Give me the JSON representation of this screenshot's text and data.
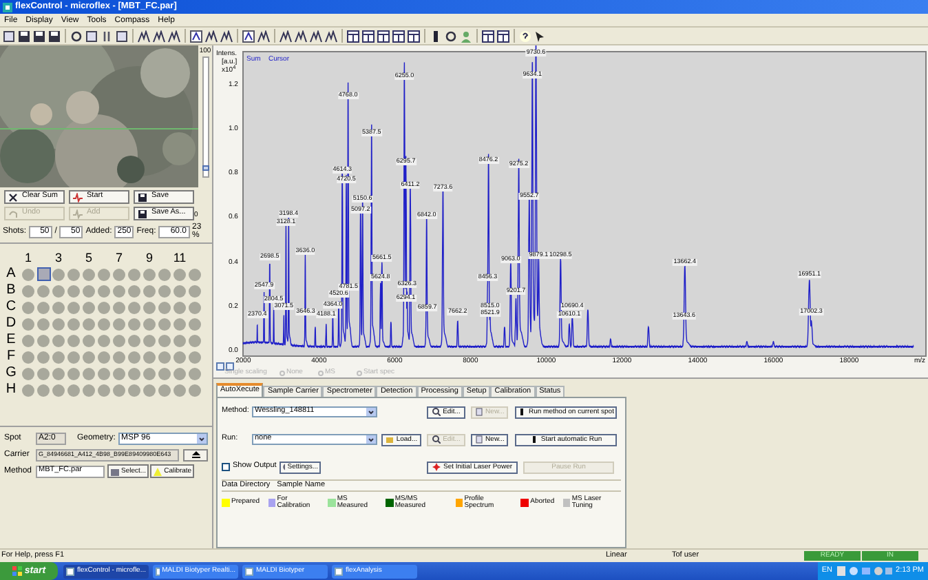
{
  "window": {
    "title": "flexControl - microflex - [MBT_FC.par]"
  },
  "menu": [
    "File",
    "Display",
    "View",
    "Tools",
    "Compass",
    "Help"
  ],
  "camera": {
    "scale_max": "100",
    "scale_min": "0",
    "level": 0.05
  },
  "acquisition_buttons": [
    {
      "label": "Clear Sum",
      "disabled": false
    },
    {
      "label": "Start",
      "disabled": false
    },
    {
      "label": "Save",
      "disabled": false
    },
    {
      "label": "Undo",
      "disabled": true
    },
    {
      "label": "Add",
      "disabled": true
    },
    {
      "label": "Save As...",
      "disabled": false
    }
  ],
  "shots": {
    "label": "Shots:",
    "value": "50",
    "separator": "/",
    "total": "50",
    "added_label": "Added:",
    "added": "250",
    "freq_label": "Freq:",
    "freq": "60.0",
    "percent": "23 %"
  },
  "plate": {
    "columns": [
      "1",
      "3",
      "5",
      "7",
      "9",
      "11"
    ],
    "rows": [
      {
        "label": "A",
        "wells": [
          {
            "selected": false
          },
          {
            "selected": true
          },
          {
            "selected": false
          },
          {
            "selected": false
          },
          {
            "selected": false
          },
          {
            "selected": false
          },
          {
            "selected": false
          },
          {
            "selected": false
          },
          {
            "selected": false
          },
          {
            "selected": false
          },
          {
            "selected": false
          },
          {
            "selected": false
          }
        ]
      },
      {
        "label": "B",
        "wells": [
          {
            "selected": false
          },
          {
            "selected": false
          },
          {
            "selected": false
          },
          {
            "selected": false
          },
          {
            "selected": false
          },
          {
            "selected": false
          },
          {
            "selected": false
          },
          {
            "selected": false
          },
          {
            "selected": false
          },
          {
            "selected": false
          },
          {
            "selected": false
          },
          {
            "selected": false
          }
        ]
      },
      {
        "label": "C",
        "wells": [
          {
            "selected": false
          },
          {
            "selected": false
          },
          {
            "selected": false
          },
          {
            "selected": false
          },
          {
            "selected": false
          },
          {
            "selected": false
          },
          {
            "selected": false
          },
          {
            "selected": false
          },
          {
            "selected": false
          },
          {
            "selected": false
          },
          {
            "selected": false
          },
          {
            "selected": false
          }
        ]
      },
      {
        "label": "D",
        "wells": [
          {
            "selected": false
          },
          {
            "selected": false
          },
          {
            "selected": false
          },
          {
            "selected": false
          },
          {
            "selected": false
          },
          {
            "selected": false
          },
          {
            "selected": false
          },
          {
            "selected": false
          },
          {
            "selected": false
          },
          {
            "selected": false
          },
          {
            "selected": false
          },
          {
            "selected": false
          }
        ]
      },
      {
        "label": "E",
        "wells": [
          {
            "selected": false
          },
          {
            "selected": false
          },
          {
            "selected": false
          },
          {
            "selected": false
          },
          {
            "selected": false
          },
          {
            "selected": false
          },
          {
            "selected": false
          },
          {
            "selected": false
          },
          {
            "selected": false
          },
          {
            "selected": false
          },
          {
            "selected": false
          },
          {
            "selected": false
          }
        ]
      },
      {
        "label": "F",
        "wells": [
          {
            "selected": false
          },
          {
            "selected": false
          },
          {
            "selected": false
          },
          {
            "selected": false
          },
          {
            "selected": false
          },
          {
            "selected": false
          },
          {
            "selected": false
          },
          {
            "selected": false
          },
          {
            "selected": false
          },
          {
            "selected": false
          },
          {
            "selected": false
          },
          {
            "selected": false
          }
        ]
      },
      {
        "label": "G",
        "wells": [
          {
            "selected": false
          },
          {
            "selected": false
          },
          {
            "selected": false
          },
          {
            "selected": false
          },
          {
            "selected": false
          },
          {
            "selected": false
          },
          {
            "selected": false
          },
          {
            "selected": false
          },
          {
            "selected": false
          },
          {
            "selected": false
          },
          {
            "selected": false
          },
          {
            "selected": false
          }
        ]
      },
      {
        "label": "H",
        "wells": [
          {
            "selected": false
          },
          {
            "selected": false
          },
          {
            "selected": false
          },
          {
            "selected": false
          },
          {
            "selected": false
          },
          {
            "selected": false
          },
          {
            "selected": false
          },
          {
            "selected": false
          },
          {
            "selected": false
          },
          {
            "selected": false
          },
          {
            "selected": false
          },
          {
            "selected": false
          }
        ]
      }
    ]
  },
  "spot": {
    "label": "Spot",
    "value": "A2:0"
  },
  "geometry": {
    "label": "Geometry:",
    "value": "MSP 96"
  },
  "carrier": {
    "label": "Carrier",
    "value": "G_84946681_A412_4B98_B99E89409980E643"
  },
  "method": {
    "label": "Method",
    "value": "MBT_FC.par",
    "buttons": [
      "Select...",
      "Calibrate"
    ]
  },
  "spectrum": {
    "y_title": "Intens.",
    "y_unit": "[a.u.]",
    "y_scale": "x10$^{4}$",
    "legend": [
      "Sum",
      "Cursor"
    ],
    "y_ticks": [
      "1.2",
      "1.0",
      "0.8",
      "0.6",
      "0.4",
      "0.2",
      "0.0"
    ],
    "x_ticks": [
      "2000",
      "4000",
      "6000",
      "8000",
      "10000",
      "12000",
      "14000",
      "16000",
      "18000"
    ],
    "x_unit": "m/z",
    "peak_labels": [
      "2370.4",
      "2547.9",
      "2698.5",
      "2804.5",
      "3071.5",
      "3198.4",
      "3128.1",
      "3636.0",
      "3646.3",
      "4188.1",
      "4520.6",
      "4364.0",
      "4768.0",
      "4614.3",
      "4720.5",
      "4781.5",
      "5150.6",
      "5097.2",
      "5387.5",
      "5661.5",
      "5624.8",
      "6255.0",
      "6295.7",
      "6411.2",
      "6326.3",
      "6294.1",
      "6842.0",
      "6859.7",
      "7273.6",
      "7662.2",
      "8476.2",
      "8456.3",
      "8515.0",
      "8521.9",
      "9275.2",
      "9063.0",
      "9201.7",
      "9730.6",
      "9634.1",
      "9552.7",
      "9879.1",
      "10298.5",
      "10690.4",
      "10610.1",
      "13662.4",
      "13643.6",
      "16951.1",
      "17002.3"
    ],
    "options": [
      {
        "label": "Single scaling",
        "kind": "checkbox"
      },
      {
        "label": "None",
        "kind": "radio"
      },
      {
        "label": "MS",
        "kind": "radio"
      },
      {
        "label": "Start spec",
        "kind": "radio"
      }
    ]
  },
  "tabs": [
    {
      "label": "AutoXecute",
      "selected": true
    },
    {
      "label": "Sample Carrier",
      "selected": false
    },
    {
      "label": "Spectrometer",
      "selected": false
    },
    {
      "label": "Detection",
      "selected": false
    },
    {
      "label": "Processing",
      "selected": false
    },
    {
      "label": "Setup",
      "selected": false
    },
    {
      "label": "Calibration",
      "selected": false
    },
    {
      "label": "Status",
      "selected": false
    }
  ],
  "autoxecute": {
    "method_label": "Method:",
    "method_value": "Wessling_148811",
    "run_label": "Run:",
    "run_value": "none",
    "show_output": {
      "label": "Show Output",
      "checked": false
    },
    "buttons": [
      {
        "label": "Edit...",
        "disabled": false
      },
      {
        "label": "New...",
        "disabled": true
      },
      {
        "label": "Run method on current spot",
        "disabled": false
      },
      {
        "label": "Load...",
        "disabled": false
      },
      {
        "label": "Edit...",
        "disabled": true
      },
      {
        "label": "New...",
        "disabled": false
      },
      {
        "label": "Start automatic Run",
        "disabled": false
      },
      {
        "label": "Settings...",
        "disabled": false
      },
      {
        "label": "Set Initial Laser Power",
        "disabled": false
      },
      {
        "label": "Pause Run",
        "disabled": true
      }
    ],
    "columns": [
      "Data Directory",
      "Sample Name"
    ]
  },
  "legend": [
    {
      "label": "Prepared",
      "color": "#ffff00"
    },
    {
      "label": "For Calibration",
      "color": "#a9a3f0"
    },
    {
      "label": "MS Measured",
      "color": "#9be39b"
    },
    {
      "label": "MS/MS Measured",
      "color": "#006400"
    },
    {
      "label": "Profile Spectrum",
      "color": "#ffa500"
    },
    {
      "label": "Aborted",
      "color": "#ee0000"
    },
    {
      "label": "MS Laser Tuning",
      "color": "#c0c0c0"
    }
  ],
  "status_bar": {
    "help": "For Help, press F1",
    "mode": "Linear",
    "user": "Tof user",
    "indicators": [
      "READY",
      "IN"
    ]
  },
  "taskbar": {
    "start": "start",
    "tasks": [
      {
        "label": "flexControl - microfle...",
        "selected": true
      },
      {
        "label": "MALDI Biotyper Realti...",
        "selected": false
      },
      {
        "label": "MALDI Biotyper",
        "selected": false
      },
      {
        "label": "flexAnalysis",
        "selected": false
      }
    ],
    "language": "EN",
    "time": "2:13 PM"
  }
}
